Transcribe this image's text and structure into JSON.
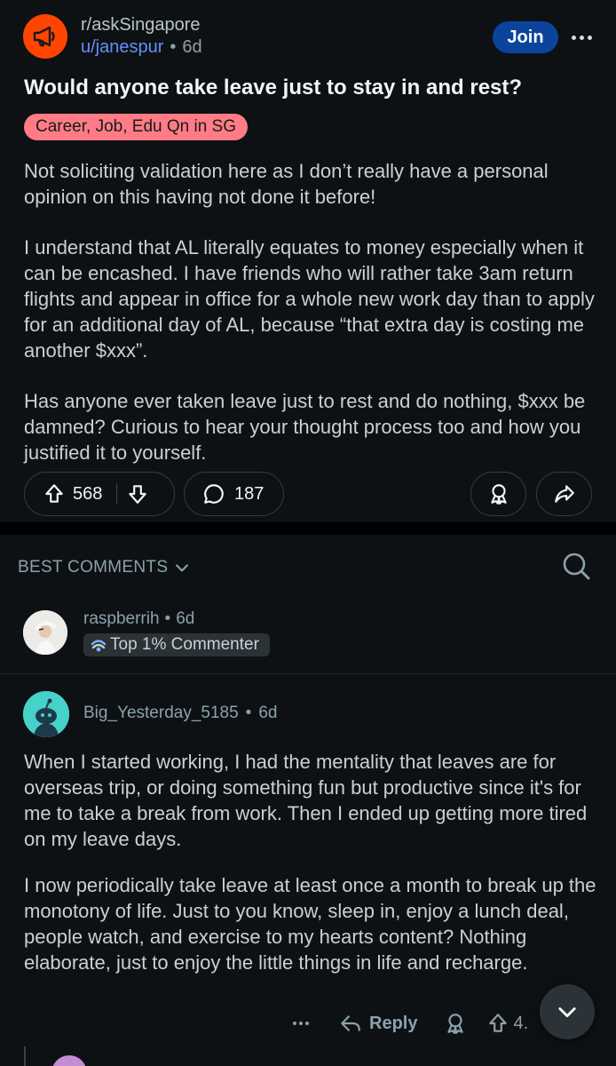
{
  "post": {
    "subreddit": "r/askSingapore",
    "author": "u/janespur",
    "separator": "•",
    "age": "6d",
    "join_label": "Join",
    "title": "Would anyone take leave just to stay in and rest?",
    "flair": "Career, Job, Edu Qn in SG",
    "paragraphs": [
      "Not soliciting validation here as I don’t really have a personal opinion on this having not done it before!",
      "I understand that AL literally equates to money especially when it can be encashed. I have friends who will rather take 3am return flights and appear in office for a whole new work day than to apply for an additional day of AL, because “that extra day is costing me another $xxx”.",
      "Has anyone ever taken leave just to rest and do nothing, $xxx be damned? Curious to hear your thought process too and how you justified it to yourself."
    ],
    "upvotes": "568",
    "comments": "187"
  },
  "comments_bar": {
    "sort_label": "BEST COMMENTS"
  },
  "comments": [
    {
      "username": "raspberrih",
      "separator": "•",
      "age": "6d",
      "badge": "Top 1% Commenter"
    },
    {
      "username": "Big_Yesterday_5185",
      "separator": "•",
      "age": "6d",
      "paragraphs": [
        "When I started working, I had the mentality that leaves are for overseas trip, or doing something fun but productive since it's for me to take a break from work. Then I ended up getting more tired on my leave days.",
        "I now periodically take leave at least once a month to break up the monotony of life. Just to you know, sleep in, enjoy a lunch deal, people watch, and exercise to my hearts content? Nothing elaborate, just to enjoy the little things in life and recharge."
      ],
      "reply_label": "Reply",
      "upvotes_partial": "4."
    }
  ],
  "colors": {
    "background": "#0e1113",
    "accent": "#0a449b",
    "flair": "#ff7c87",
    "subreddit_icon": "#ff4500",
    "link": "#648efc"
  },
  "icons": [
    "megaphone-icon",
    "more-icon",
    "upvote-icon",
    "downvote-icon",
    "comment-icon",
    "award-icon",
    "share-icon",
    "chevron-down-icon",
    "search-icon",
    "reply-icon",
    "scroll-down-icon"
  ]
}
